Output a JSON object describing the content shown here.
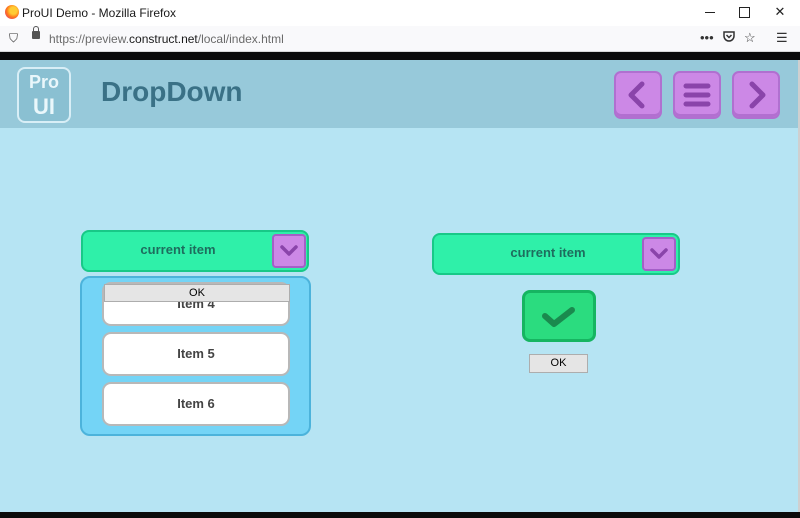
{
  "window": {
    "title": "ProUI Demo - Mozilla Firefox",
    "url_prefix": "https://preview.",
    "url_domain": "construct.net",
    "url_path": "/local/index.html"
  },
  "header": {
    "logo_top": "Pro",
    "logo_bottom": "UI",
    "title": "DropDown"
  },
  "left_dropdown": {
    "label": "current item",
    "items": [
      "Item 4",
      "Item 5",
      "Item 6"
    ],
    "ok_label": "OK"
  },
  "right_dropdown": {
    "label": "current item",
    "ok_label": "OK"
  },
  "colors": {
    "page_bg": "#b6e4f3",
    "header_bg": "#97c9da",
    "dropdown_green": "#2ff0a9",
    "accent_purple": "#cc88e6",
    "list_panel": "#74d4f6"
  },
  "icons": [
    "firefox-icon",
    "shield-icon",
    "lock-icon",
    "more-icon",
    "pocket-icon",
    "star-icon",
    "hamburger-icon",
    "chevron-left-icon",
    "chevron-right-icon",
    "chevron-down-icon",
    "checkmark-icon"
  ]
}
